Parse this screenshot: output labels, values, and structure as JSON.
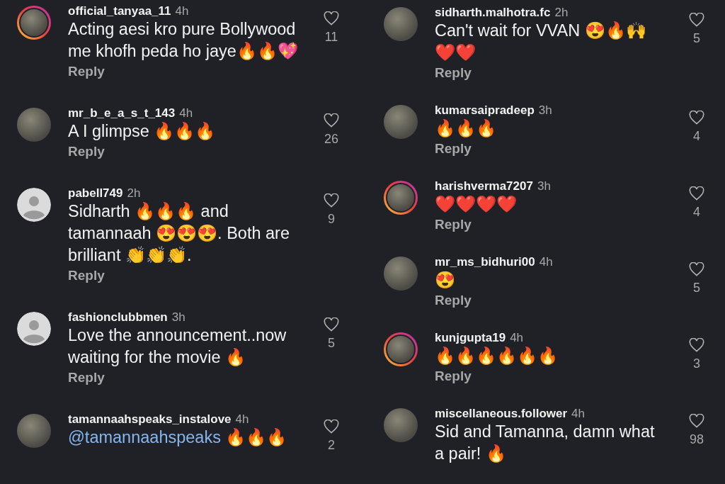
{
  "columns": [
    {
      "comments": [
        {
          "username": "official_tanyaa_11",
          "time": "4h",
          "kind": "photo",
          "story_ring": true,
          "text": "Acting aesi kro pure Bollywood me khofh peda ho jaye🔥🔥💖",
          "reply": "Reply",
          "liked": false,
          "likes": "11"
        },
        {
          "username": "mr_b_e_a_s_t_143",
          "time": "4h",
          "kind": "photo",
          "story_ring": false,
          "text": "A I  glimpse 🔥🔥🔥",
          "reply": "Reply",
          "liked": false,
          "likes": "26"
        },
        {
          "username": "pabell749",
          "time": "2h",
          "kind": "default",
          "story_ring": false,
          "text": "Sidharth 🔥🔥🔥 and tamannaah 😍😍😍. Both are brilliant 👏👏👏.",
          "reply": "Reply",
          "liked": false,
          "likes": "9"
        },
        {
          "username": "fashionclubbmen",
          "time": "3h",
          "kind": "default",
          "story_ring": false,
          "text": "Love the announcement..now waiting for the movie 🔥",
          "reply": "Reply",
          "liked": false,
          "likes": "5"
        },
        {
          "username": "tamannaahspeaks_instalove",
          "time": "4h",
          "kind": "photo",
          "story_ring": false,
          "mention": "@tamannaahspeaks",
          "text": "🔥🔥🔥",
          "liked": false,
          "likes": "2"
        }
      ]
    },
    {
      "comments": [
        {
          "username": "sidharth.malhotra.fc",
          "time": "2h",
          "kind": "photo",
          "story_ring": false,
          "text": "Can't wait for VVAN 😍🔥🙌 ❤️❤️",
          "reply": "Reply",
          "liked": false,
          "likes": "5"
        },
        {
          "username": "kumarsaipradeep",
          "time": "3h",
          "kind": "photo",
          "story_ring": false,
          "text": "🔥🔥🔥",
          "reply": "Reply",
          "liked": false,
          "likes": "4"
        },
        {
          "username": "harishverma7207",
          "time": "3h",
          "kind": "photo",
          "story_ring": true,
          "text": "❤️❤️❤️❤️",
          "reply": "Reply",
          "liked": false,
          "likes": "4"
        },
        {
          "username": "mr_ms_bidhuri00",
          "time": "4h",
          "kind": "photo",
          "story_ring": false,
          "text": "😍",
          "reply": "Reply",
          "liked": false,
          "likes": "5"
        },
        {
          "username": "kunjgupta19",
          "time": "4h",
          "kind": "photo",
          "story_ring": true,
          "text": "🔥🔥🔥🔥🔥🔥",
          "reply": "Reply",
          "liked": false,
          "likes": "3"
        },
        {
          "username": "miscellaneous.follower",
          "time": "4h",
          "kind": "photo",
          "story_ring": false,
          "text": "Sid and Tamanna, damn what a pair! 🔥",
          "liked": false,
          "likes": "98"
        }
      ]
    }
  ]
}
